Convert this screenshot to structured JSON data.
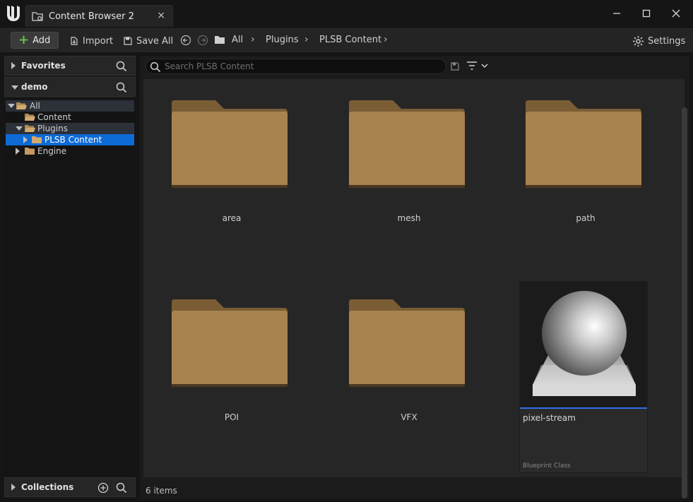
{
  "window": {
    "tab_title": "Content Browser 2",
    "tab_close": "×",
    "minimize": "—",
    "maximize": "☐",
    "close": "✕"
  },
  "toolbar": {
    "add_label": "Add",
    "import_label": "Import",
    "save_all_label": "Save All",
    "settings_label": "Settings",
    "breadcrumb": [
      "All",
      "Plugins",
      "PLSB Content"
    ]
  },
  "left_panel": {
    "favorites_label": "Favorites",
    "project_label": "demo",
    "collections_label": "Collections",
    "tree": [
      {
        "label": "All"
      },
      {
        "label": "Content"
      },
      {
        "label": "Plugins"
      },
      {
        "label": "PLSB Content",
        "selected": true
      },
      {
        "label": "Engine"
      }
    ]
  },
  "content": {
    "search_placeholder": "Search PLSB Content",
    "folders": [
      "area",
      "mesh",
      "path",
      "POI",
      "VFX"
    ],
    "asset": {
      "name": "pixel-stream",
      "type": "Blueprint Class"
    },
    "status": "6 items"
  },
  "colors": {
    "accent": "#2f6ee8",
    "selection": "#0e6ad4",
    "folder": "#b08a55",
    "add_plus": "#66c04b"
  }
}
